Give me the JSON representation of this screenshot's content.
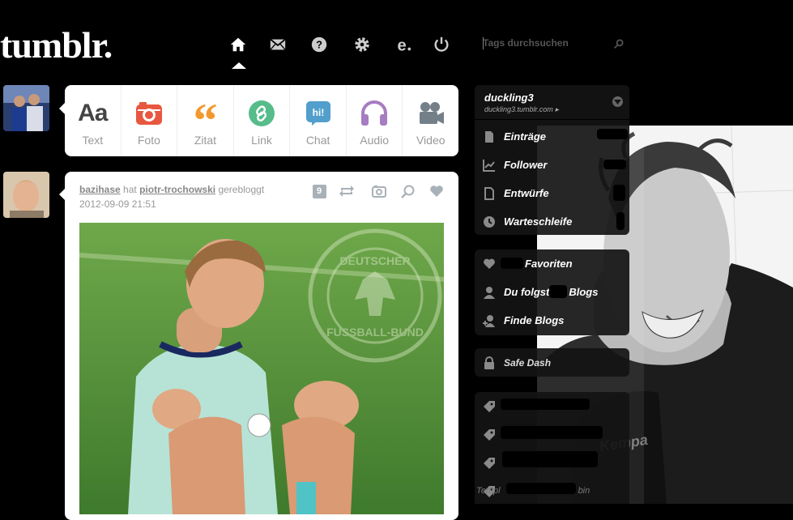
{
  "header": {
    "logo": "tumblr.",
    "nav_icons": [
      "home-icon",
      "mail-icon",
      "help-icon",
      "gear-icon",
      "edit-icon",
      "power-icon"
    ],
    "search_placeholder": "Tags durchsuchen"
  },
  "post_form": {
    "items": [
      {
        "label": "Text",
        "icon": "text-icon",
        "color": "#444444"
      },
      {
        "label": "Foto",
        "icon": "camera-icon",
        "color": "#e8573f"
      },
      {
        "label": "Zitat",
        "icon": "quote-icon",
        "color": "#f2992e"
      },
      {
        "label": "Link",
        "icon": "link-icon",
        "color": "#56bc8a"
      },
      {
        "label": "Chat",
        "icon": "chat-icon",
        "color": "#529ecc"
      },
      {
        "label": "Audio",
        "icon": "headphones-icon",
        "color": "#a77dc2"
      },
      {
        "label": "Video",
        "icon": "video-icon",
        "color": "#748089"
      }
    ],
    "chat_badge": "hi!"
  },
  "post": {
    "user": "bazihase",
    "action": "hat",
    "source": "piotr-trochowski",
    "action2": "gerebloggt",
    "date": "2012-09-09 21:51",
    "notes_count": "9",
    "photo_text_top": "DEUTSCHER",
    "photo_text_bottom": "FUSSBALL-BUND"
  },
  "sidebar": {
    "blog_name": "duckling3",
    "blog_url": "duckling3.tumblr.com",
    "blog_url_arrow": "▸",
    "stats": [
      {
        "label": "Einträge",
        "icon": "document-icon"
      },
      {
        "label": "Follower",
        "icon": "chart-icon"
      },
      {
        "label": "Entwürfe",
        "icon": "draft-icon"
      },
      {
        "label": "Warteschleife",
        "icon": "clock-icon"
      }
    ],
    "links": [
      {
        "label": "Favoriten",
        "icon": "heart-icon"
      },
      {
        "label": "Du folgst",
        "label2": "Blogs",
        "icon": "person-icon"
      },
      {
        "label": "Finde Blogs",
        "icon": "add-person-icon"
      }
    ],
    "safe_dash": "Safe Dash",
    "template_text": "Templ",
    "template_text2": "bin"
  },
  "colors": {
    "background": "#000000",
    "card": "#ffffff",
    "sidebar": "#141414"
  }
}
